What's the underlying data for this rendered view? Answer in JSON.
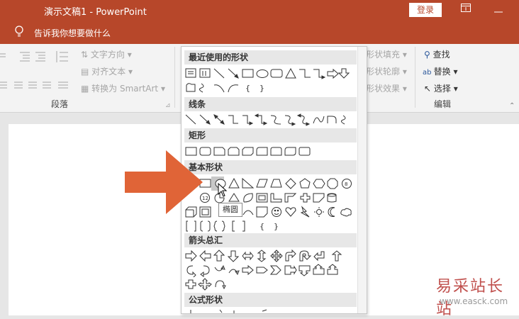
{
  "titlebar": {
    "title": "演示文稿1  -  PowerPoint",
    "login": "登录"
  },
  "tellme": {
    "text": "告诉我你想要做什么"
  },
  "ribbon": {
    "text_direction": "文字方向",
    "align_text": "对齐文本",
    "convert_smartart": "转换为 SmartArt",
    "group_paragraph": "段落",
    "shape_fill": "形状填充",
    "shape_outline": "形状轮廓",
    "shape_effects": "形状效果",
    "find": "查找",
    "replace": "替换",
    "select": "选择",
    "group_editing": "编辑"
  },
  "shapes_panel": {
    "sections": [
      {
        "title": "最近使用的形状"
      },
      {
        "title": "线条"
      },
      {
        "title": "矩形"
      },
      {
        "title": "基本形状"
      },
      {
        "title": "箭头总汇"
      },
      {
        "title": "公式形状"
      }
    ],
    "tooltip": "椭圆"
  },
  "watermark": {
    "cn": "易采站长站",
    "url": "www.easck.com"
  },
  "colors": {
    "titlebar": "#b7472a",
    "arrow": "#e06437"
  }
}
